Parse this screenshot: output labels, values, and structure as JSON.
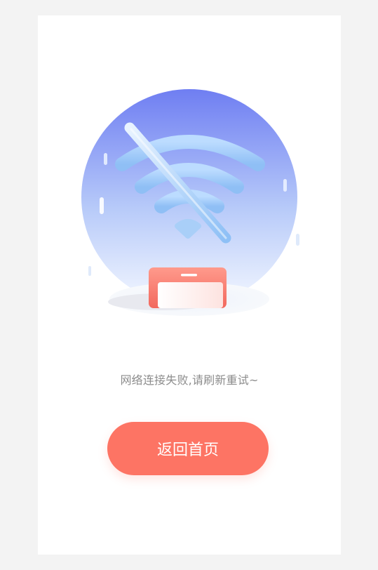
{
  "error": {
    "message": "网络连接失败,请刷新重试~"
  },
  "actions": {
    "home_label": "返回首页"
  },
  "colors": {
    "page_bg": "#f3f3f3",
    "card_bg": "#ffffff",
    "accent": "#fd7464",
    "circle_top": "#6f7ef2",
    "circle_bottom": "#eef4ff",
    "wifi": "#a9cff8"
  },
  "illustration": {
    "icon": "wifi-off-icon",
    "device": "phone-icon"
  }
}
